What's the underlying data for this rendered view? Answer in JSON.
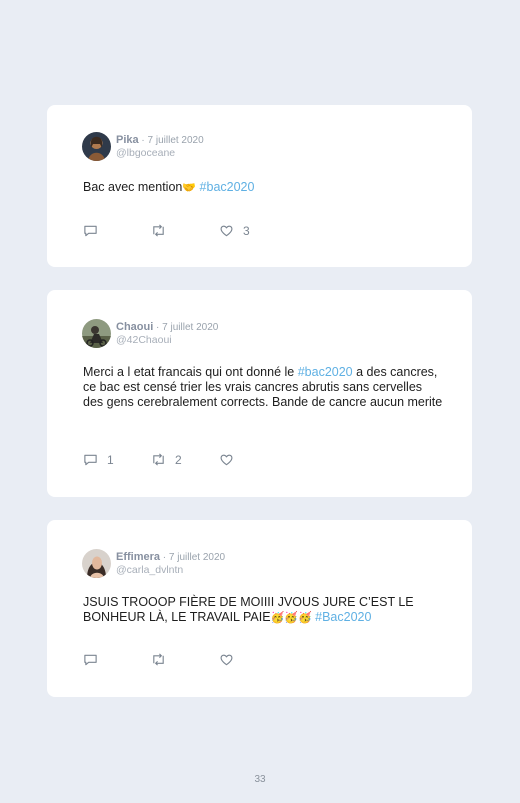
{
  "tweets": [
    {
      "name": "Pika",
      "date": " · 7 juillet 2020",
      "handle": "@lbgoceane",
      "text": "Bac avec mention",
      "emoji": "🤝",
      "hashtag": " #bac2020",
      "text_after": "",
      "replies": "",
      "retweets": "",
      "likes": "3"
    },
    {
      "name": "Chaoui",
      "date": " · 7 juillet 2020",
      "handle": "@42Chaoui",
      "text": "Merci a l etat francais qui ont donné le ",
      "emoji": "",
      "hashtag": "#bac2020",
      "text_after": " a des cancres, ce bac est censé trier les vrais cancres abrutis sans cervelles des gens cerebralement corrects. Bande de cancre aucun merite",
      "replies": "1",
      "retweets": "2",
      "likes": ""
    },
    {
      "name": "Effimera",
      "date": " · 7 juillet 2020",
      "handle": "@carla_dvlntn",
      "text": "JSUIS TROOOP FIÈRE DE MOIIII JVOUS JURE C’EST LE BONHEUR LÀ, LE TRAVAIL PAIE",
      "emoji": "🥳🥳🥳",
      "hashtag": " #Bac2020",
      "text_after": "",
      "replies": "",
      "retweets": "",
      "likes": ""
    }
  ],
  "page_number": "33",
  "icons": {
    "reply": "speech-bubble-icon",
    "retweet": "retweet-icon",
    "like": "heart-icon"
  },
  "colors": {
    "background": "#e9edf4",
    "card": "#ffffff",
    "hashtag": "#5fb0e3"
  }
}
